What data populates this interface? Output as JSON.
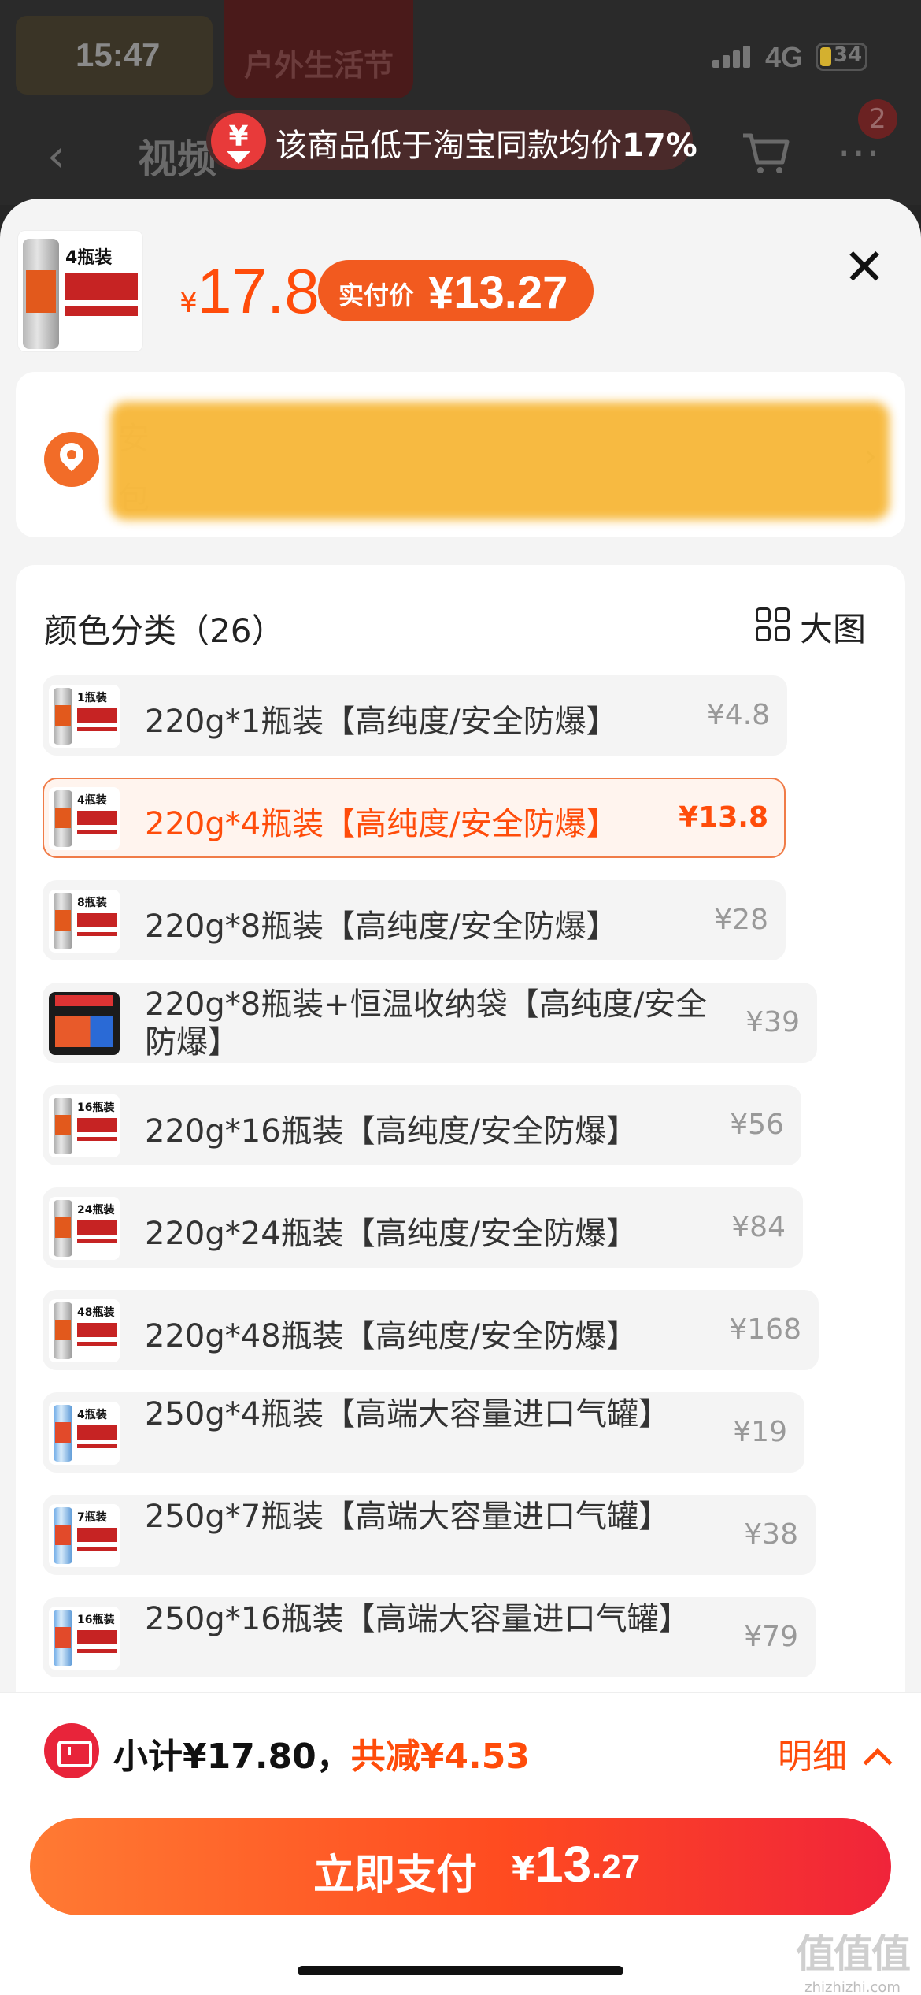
{
  "status_bar": {
    "time": "15:47",
    "network": "4G",
    "battery": "34"
  },
  "background": {
    "banner": "户外生活节",
    "tab": "视频",
    "cart_badge": "2"
  },
  "price_compare": {
    "text": "该商品低于淘宝同款均价",
    "percent": "17%"
  },
  "header": {
    "thumb_label": "4瓶装",
    "price": "17.8",
    "currency": "¥",
    "pay_label": "实付价",
    "pay_price": "¥13.27",
    "close": "✕"
  },
  "address": {
    "line1": "安",
    "line2": "包",
    "chevron": "›"
  },
  "options_section": {
    "title": "颜色分类（26）",
    "big_image_label": "大图",
    "items": [
      {
        "name": "220g*1瓶装【高纯度/安全防爆】",
        "price": "¥4.8",
        "thumb": "1瓶装"
      },
      {
        "name": "220g*4瓶装【高纯度/安全防爆】",
        "price": "¥13.8",
        "thumb": "4瓶装",
        "selected": true
      },
      {
        "name": "220g*8瓶装【高纯度/安全防爆】",
        "price": "¥28",
        "thumb": "8瓶装"
      },
      {
        "name": "220g*8瓶装+恒温收纳袋【高纯度/安全防爆】",
        "price": "¥39",
        "thumb": ""
      },
      {
        "name": "220g*16瓶装【高纯度/安全防爆】",
        "price": "¥56",
        "thumb": "16瓶装"
      },
      {
        "name": "220g*24瓶装【高纯度/安全防爆】",
        "price": "¥84",
        "thumb": "24瓶装"
      },
      {
        "name": "220g*48瓶装【高纯度/安全防爆】",
        "price": "¥168",
        "thumb": "48瓶装"
      },
      {
        "name": "250g*4瓶装【高端大容量进口气罐】",
        "price": "¥19",
        "thumb": "4瓶装"
      },
      {
        "name": "250g*7瓶装【高端大容量进口气罐】",
        "price": "¥38",
        "thumb": "7瓶装"
      },
      {
        "name": "250g*16瓶装【高端大容量进口气罐】",
        "price": "¥79",
        "thumb": "16瓶装"
      }
    ]
  },
  "footer": {
    "subtotal_label": "小计¥17.80，",
    "discount": "共减¥4.53",
    "detail_label": "明细",
    "pay_label": "立即支付",
    "pay_currency": "¥",
    "pay_amount": "13",
    "pay_decimal": ".27"
  },
  "watermark": {
    "logo": "值值值",
    "site": "zhizhizhi.com"
  }
}
